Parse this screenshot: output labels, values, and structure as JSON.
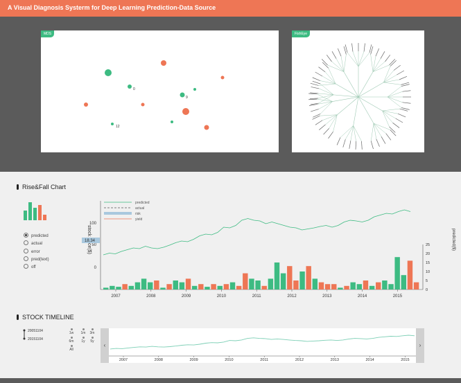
{
  "header": {
    "title": "A Visual Diagnosis Systerm for Deep Learning Prediction-Data Source"
  },
  "colors": {
    "accent": "#ee7655",
    "green": "#3dbb82",
    "dark": "#5b5b5b"
  },
  "mds": {
    "tag": "MDS",
    "points": [
      {
        "color": "green",
        "r": 5,
        "label": ""
      },
      {
        "color": "orange",
        "r": 4,
        "label": ""
      },
      {
        "color": "green",
        "r": 3,
        "label": "0"
      },
      {
        "color": "orange",
        "r": 2.5,
        "label": ""
      },
      {
        "color": "orange",
        "r": 3,
        "label": ""
      },
      {
        "color": "green",
        "r": 3.5,
        "label": "9"
      },
      {
        "color": "green",
        "r": 2,
        "label": ""
      },
      {
        "color": "orange",
        "r": 2.5,
        "label": ""
      },
      {
        "color": "orange",
        "r": 5,
        "label": ""
      },
      {
        "color": "green",
        "r": 2,
        "label": ""
      },
      {
        "color": "orange",
        "r": 3.5,
        "label": ""
      },
      {
        "color": "green",
        "r": 2,
        "label": "12"
      }
    ]
  },
  "fisheye": {
    "tag": "FishEye"
  },
  "risefall": {
    "title": "Rise&Fall Chart",
    "radios": [
      {
        "label": "predicted",
        "checked": true
      },
      {
        "label": "actual",
        "checked": false
      },
      {
        "label": "error",
        "checked": false
      },
      {
        "label": "pred(text)",
        "checked": false
      },
      {
        "label": "off",
        "checked": false
      }
    ],
    "legend": [
      "predicted",
      "actual",
      "risk",
      "yield"
    ],
    "current_value": "18.34"
  },
  "chart_data": {
    "type": "line",
    "ylabel": "stock price($)",
    "ylabel_right": "predicted($)",
    "y_ticks_left": [
      "0",
      "50",
      "100"
    ],
    "y_ticks_right": [
      "0",
      "5",
      "10",
      "15",
      "20",
      "25"
    ],
    "x_ticks": [
      "2007",
      "2008",
      "2009",
      "2010",
      "2011",
      "2012",
      "2013",
      "2014",
      "2015"
    ],
    "series": [
      {
        "name": "predicted",
        "color": "#3dbb82",
        "values": [
          40,
          45,
          43,
          50,
          55,
          60,
          58,
          65,
          60,
          58,
          62,
          68,
          75,
          80,
          78,
          85,
          95,
          100,
          98,
          105,
          120,
          118,
          125,
          140,
          145,
          140,
          138,
          130,
          135,
          130,
          125,
          120,
          118,
          112,
          115,
          118,
          122,
          125,
          120,
          125,
          135,
          140,
          138,
          135,
          140,
          150,
          155,
          160,
          158,
          165,
          170,
          165
        ]
      }
    ],
    "bars": [
      {
        "year_pos": 0.02,
        "value": 1,
        "color": "green"
      },
      {
        "year_pos": 0.04,
        "value": 2,
        "color": "green"
      },
      {
        "year_pos": 0.06,
        "value": 1.5,
        "color": "green"
      },
      {
        "year_pos": 0.08,
        "value": 3,
        "color": "orange"
      },
      {
        "year_pos": 0.1,
        "value": 2,
        "color": "green"
      },
      {
        "year_pos": 0.12,
        "value": 4,
        "color": "green"
      },
      {
        "year_pos": 0.14,
        "value": 6,
        "color": "green"
      },
      {
        "year_pos": 0.16,
        "value": 4,
        "color": "green"
      },
      {
        "year_pos": 0.18,
        "value": 5,
        "color": "orange"
      },
      {
        "year_pos": 0.2,
        "value": 1,
        "color": "green"
      },
      {
        "year_pos": 0.22,
        "value": 3,
        "color": "orange"
      },
      {
        "year_pos": 0.24,
        "value": 5,
        "color": "green"
      },
      {
        "year_pos": 0.26,
        "value": 4,
        "color": "green"
      },
      {
        "year_pos": 0.28,
        "value": 6,
        "color": "orange"
      },
      {
        "year_pos": 0.3,
        "value": 2,
        "color": "green"
      },
      {
        "year_pos": 0.32,
        "value": 3,
        "color": "orange"
      },
      {
        "year_pos": 0.34,
        "value": 1.5,
        "color": "green"
      },
      {
        "year_pos": 0.36,
        "value": 3,
        "color": "orange"
      },
      {
        "year_pos": 0.38,
        "value": 2,
        "color": "green"
      },
      {
        "year_pos": 0.4,
        "value": 3,
        "color": "orange"
      },
      {
        "year_pos": 0.42,
        "value": 4,
        "color": "green"
      },
      {
        "year_pos": 0.44,
        "value": 2,
        "color": "orange"
      },
      {
        "year_pos": 0.46,
        "value": 9,
        "color": "orange"
      },
      {
        "year_pos": 0.48,
        "value": 6,
        "color": "green"
      },
      {
        "year_pos": 0.5,
        "value": 5,
        "color": "green"
      },
      {
        "year_pos": 0.52,
        "value": 2,
        "color": "orange"
      },
      {
        "year_pos": 0.54,
        "value": 6,
        "color": "green"
      },
      {
        "year_pos": 0.56,
        "value": 15,
        "color": "green"
      },
      {
        "year_pos": 0.58,
        "value": 9,
        "color": "green"
      },
      {
        "year_pos": 0.6,
        "value": 13,
        "color": "orange"
      },
      {
        "year_pos": 0.62,
        "value": 5,
        "color": "orange"
      },
      {
        "year_pos": 0.64,
        "value": 10,
        "color": "green"
      },
      {
        "year_pos": 0.66,
        "value": 13,
        "color": "orange"
      },
      {
        "year_pos": 0.68,
        "value": 6,
        "color": "green"
      },
      {
        "year_pos": 0.7,
        "value": 4,
        "color": "orange"
      },
      {
        "year_pos": 0.72,
        "value": 3,
        "color": "orange"
      },
      {
        "year_pos": 0.74,
        "value": 3,
        "color": "orange"
      },
      {
        "year_pos": 0.76,
        "value": 1,
        "color": "green"
      },
      {
        "year_pos": 0.78,
        "value": 2,
        "color": "orange"
      },
      {
        "year_pos": 0.8,
        "value": 4,
        "color": "green"
      },
      {
        "year_pos": 0.82,
        "value": 3,
        "color": "green"
      },
      {
        "year_pos": 0.84,
        "value": 5,
        "color": "orange"
      },
      {
        "year_pos": 0.86,
        "value": 2,
        "color": "green"
      },
      {
        "year_pos": 0.88,
        "value": 4,
        "color": "orange"
      },
      {
        "year_pos": 0.9,
        "value": 5,
        "color": "green"
      },
      {
        "year_pos": 0.92,
        "value": 3,
        "color": "green"
      },
      {
        "year_pos": 0.94,
        "value": 18,
        "color": "green"
      },
      {
        "year_pos": 0.96,
        "value": 8,
        "color": "green"
      },
      {
        "year_pos": 0.98,
        "value": 16,
        "color": "orange"
      },
      {
        "year_pos": 1.0,
        "value": 4,
        "color": "orange"
      }
    ]
  },
  "timeline": {
    "title": "STOCK TIMELINE",
    "start_date": "20051104",
    "end_date": "20151104",
    "zoom_buttons": [
      "1w",
      "1m",
      "3m",
      "6m",
      "1y",
      "5y",
      "All"
    ],
    "x_ticks": [
      "2007",
      "2008",
      "2009",
      "2010",
      "2011",
      "2012",
      "2013",
      "2014",
      "2015"
    ],
    "prev": "‹",
    "next": "›"
  }
}
